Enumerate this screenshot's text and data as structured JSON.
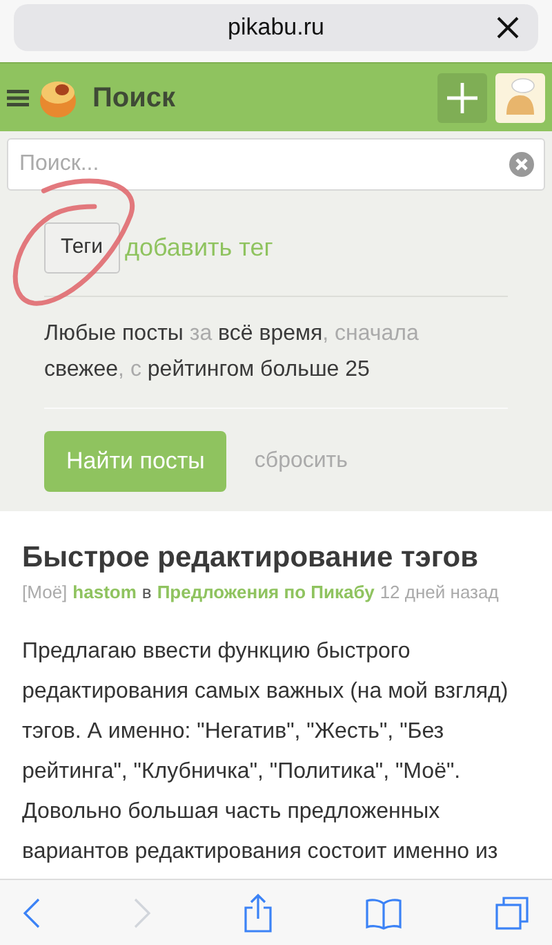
{
  "browser": {
    "address": "pikabu.ru"
  },
  "header": {
    "title": "Поиск"
  },
  "search": {
    "placeholder": "Поиск..."
  },
  "tags": {
    "button": "Теги",
    "add_link": "добавить тег"
  },
  "filter_summary": [
    {
      "text": "Любые посты",
      "kind": "value"
    },
    {
      "text": " за ",
      "kind": "connector"
    },
    {
      "text": "всё время",
      "kind": "value"
    },
    {
      "text": ", сначала ",
      "kind": "connector"
    },
    {
      "text": "свежее",
      "kind": "value"
    },
    {
      "text": ", с ",
      "kind": "connector"
    },
    {
      "text": "рейтингом больше 25",
      "kind": "value"
    }
  ],
  "actions": {
    "submit": "Найти посты",
    "reset": "сбросить"
  },
  "post": {
    "title": "Быстрое редактирование тэгов",
    "tag": "[Моё]",
    "author": "hastom",
    "preposition": "в",
    "community": "Предложения по Пикабу",
    "time": "12 дней назад",
    "body": "Предлагаю ввести функцию быстрого редактирования самых важных (на мой взгляд) тэгов. А именно: \"Негатив\", \"Жесть\", \"Без рейтинга\", \"Клубничка\", \"Политика\", \"Моё\". Довольно большая часть предложенных вариантов редактирования состоит именно из"
  },
  "toolbar": [
    {
      "kind": "back",
      "disabled": false
    },
    {
      "kind": "forward",
      "disabled": true
    },
    {
      "kind": "share",
      "disabled": false
    },
    {
      "kind": "bookmarks",
      "disabled": false
    },
    {
      "kind": "tabs",
      "disabled": false
    }
  ]
}
